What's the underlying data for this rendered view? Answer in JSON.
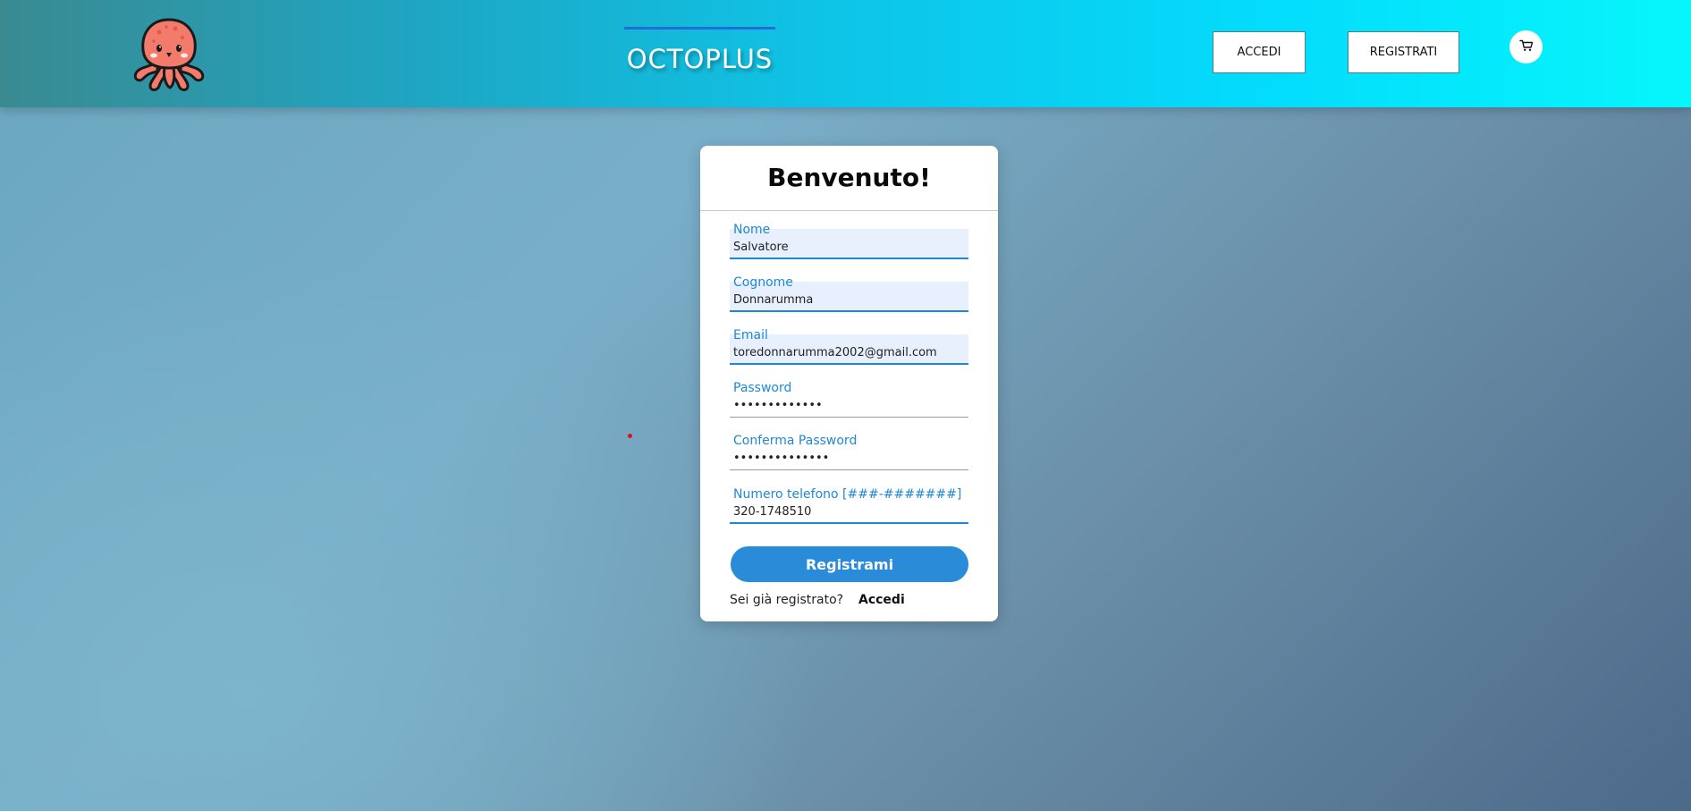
{
  "header": {
    "brand": "OCTOPLUS",
    "login_button": "ACCEDI",
    "register_button": "REGISTRATI",
    "cart_icon": "cart-icon",
    "logo_icon": "octopus-logo",
    "colors": {
      "gradient_start": "#3a8a90",
      "gradient_end": "#06f6fb",
      "brand_underline": "#1f6fd6"
    }
  },
  "form": {
    "title": "Benvenuto!",
    "fields": [
      {
        "label": "Nome",
        "value": "Salvatore"
      },
      {
        "label": "Cognome",
        "value": "Donnarumma"
      },
      {
        "label": "Email",
        "value": "toredonnarumma2002@gmail.com"
      },
      {
        "label": "Password",
        "value": "•••••••••••••"
      },
      {
        "label": "Conferma Password",
        "value": "••••••••••••••"
      },
      {
        "label": "Numero telefono [###-#######]",
        "value": "320-1748510"
      }
    ],
    "submit_button": "Registrami",
    "login_prompt": "Sei già registrato?",
    "login_link": "Accedi",
    "colors": {
      "accent": "#1e88d6",
      "button": "#2a8bd9",
      "autofill_bg": "#e8f0fe"
    }
  }
}
